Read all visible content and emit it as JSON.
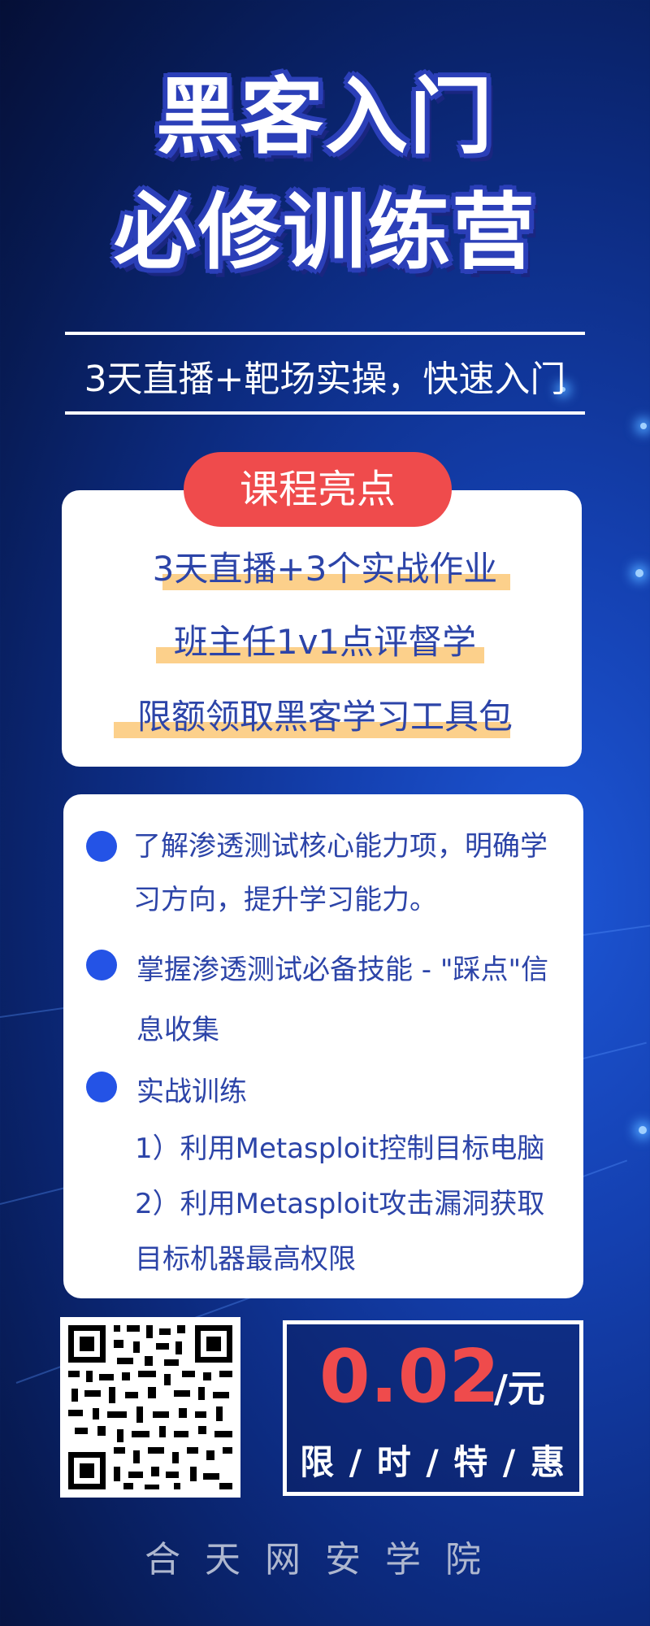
{
  "headline": {
    "line1": "黑客入门",
    "line2": "必修训练营"
  },
  "subtitle": "3天直播+靶场实操，快速入门",
  "highlights": {
    "badge": "课程亮点",
    "items": [
      "3天直播+3个实战作业",
      "班主任1v1点评督学",
      "限额领取黑客学习工具包"
    ]
  },
  "features": {
    "item1": {
      "line1": "了解渗透测试核心能力项，明确学",
      "line2": "习方向，提升学习能力。"
    },
    "item2": {
      "line1": "掌握渗透测试必备技能 - \"踩点\"信",
      "line2": "息收集"
    },
    "item3": {
      "line1": "实战训练",
      "line2": "1）利用Metasploit控制目标电脑",
      "line3": "2）利用Metasploit攻击漏洞获取",
      "line4": "目标机器最高权限"
    }
  },
  "price": {
    "value": "0.02",
    "unit": "/元",
    "tagline": "限 / 时 / 特 / 惠"
  },
  "footer": "合天网安学院",
  "colors": {
    "accent_red": "#ef4b4c",
    "text_blue": "#2c44a8",
    "bullet_blue": "#2453e6",
    "marker_yellow": "#fcd08b"
  },
  "icons": {
    "qr": "qr-code-icon",
    "bullet": "bullet-dot-icon"
  }
}
